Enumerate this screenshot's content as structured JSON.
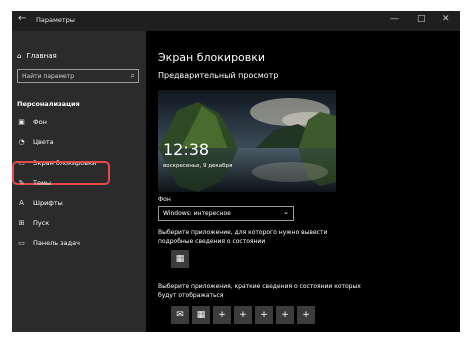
{
  "window": {
    "title": "Параметры",
    "back_icon": "arrow-left-icon",
    "controls": [
      "—",
      "□",
      "✕"
    ]
  },
  "sidebar": {
    "home_label": "Главная",
    "search_placeholder": "Найти параметр",
    "section_title": "Персонализация",
    "items": [
      {
        "label": "Фон",
        "icon": "image-icon"
      },
      {
        "label": "Цвета",
        "icon": "palette-icon"
      },
      {
        "label": "Экран блокировки",
        "icon": "lock-screen-icon"
      },
      {
        "label": "Темы",
        "icon": "brush-icon"
      },
      {
        "label": "Шрифты",
        "icon": "font-icon"
      },
      {
        "label": "Пуск",
        "icon": "start-icon"
      },
      {
        "label": "Панель задач",
        "icon": "taskbar-icon"
      }
    ],
    "selected_index": 2,
    "selection_highlight_color": "#e8484a"
  },
  "main": {
    "title": "Экран блокировки",
    "preview_heading": "Предварительный просмотр",
    "preview": {
      "time": "12:38",
      "date": "воскресенье, 9 декабря"
    },
    "background_label": "Фон",
    "background_value": "Windows: интересное",
    "detail_app_label": "Выберите приложение, для которого нужно вывести подробные сведения о состоянии",
    "quick_apps_label": "Выберите приложения, краткие сведения о состоянии которых будут отображаться",
    "quick_tiles": [
      "mail-icon",
      "calendar-icon",
      "+",
      "+",
      "+",
      "+",
      "+"
    ]
  },
  "colors": {
    "sidebar_bg": "#2b2b2b",
    "content_bg": "#000000",
    "tile_bg": "#3c3c3c"
  }
}
